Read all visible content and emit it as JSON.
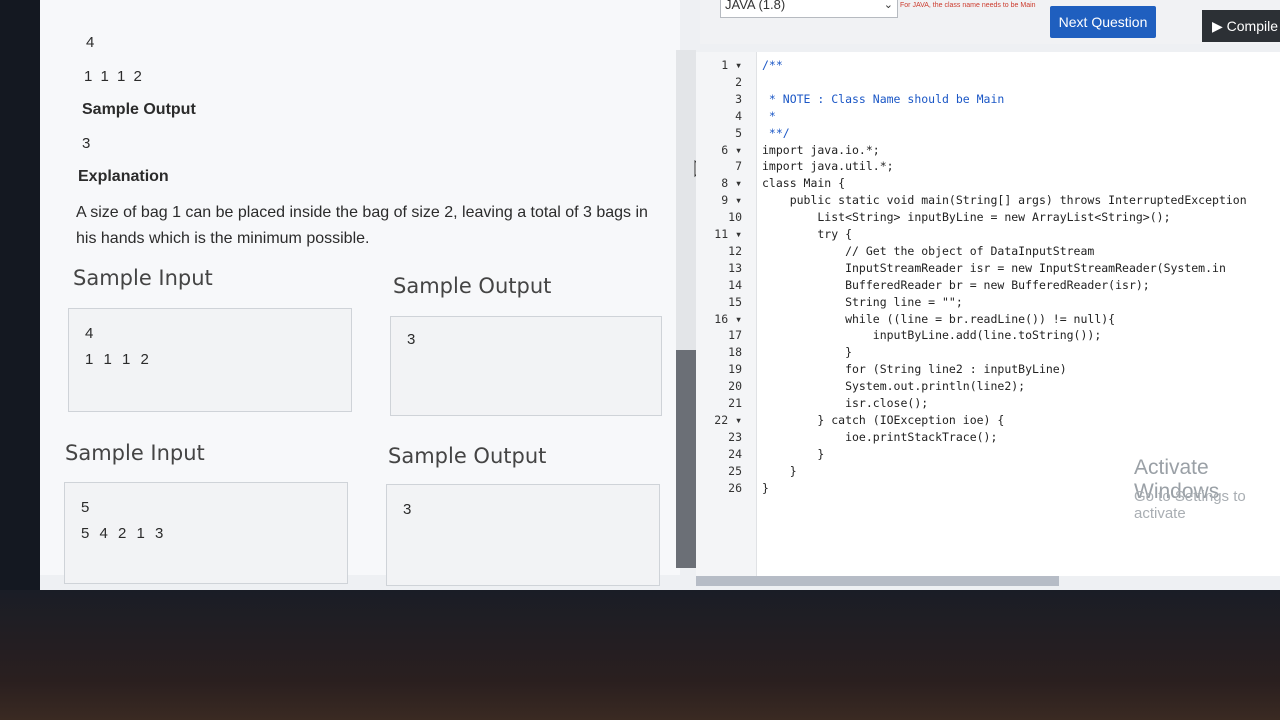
{
  "problem": {
    "top_value_1": "4",
    "top_value_2": "1 1 1 2",
    "sample_output_heading": "Sample Output",
    "sample_output_value": "3",
    "explanation_heading": "Explanation",
    "explanation_text": "A size of bag 1 can be placed inside the bag of size 2, leaving a total of 3 bags in his hands which is the minimum possible.",
    "examples": [
      {
        "input_label": "Sample Input",
        "output_label": "Sample Output",
        "input_lines": [
          "4",
          "1 1 1 2"
        ],
        "output": "3"
      },
      {
        "input_label": "Sample Input",
        "output_label": "Sample Output",
        "input_lines": [
          "5",
          "5 4 2 1 3"
        ],
        "output": "3"
      }
    ]
  },
  "toolbar": {
    "language": "JAVA (1.8)",
    "note": "For JAVA, the class name needs to be Main",
    "next_label": "Next Question",
    "compile_label": "▶ Compile"
  },
  "editor": {
    "line_numbers": [
      "1",
      "2",
      "3",
      "4",
      "5",
      "6",
      "7",
      "8",
      "9",
      "10",
      "11",
      "12",
      "13",
      "14",
      "15",
      "16",
      "17",
      "18",
      "19",
      "20",
      "21",
      "22",
      "23",
      "24",
      "25",
      "26"
    ],
    "lines": [
      "/**",
      "",
      " * NOTE : Class Name should be Main",
      " *",
      " **/",
      "import java.io.*;",
      "import java.util.*;",
      "class Main {",
      "    public static void main(String[] args) throws InterruptedException",
      "        List<String> inputByLine = new ArrayList<String>();",
      "        try {",
      "            // Get the object of DataInputStream",
      "            InputStreamReader isr = new InputStreamReader(System.in",
      "            BufferedReader br = new BufferedReader(isr);",
      "            String line = \"\";",
      "            while ((line = br.readLine()) != null){",
      "                inputByLine.add(line.toString());",
      "            }",
      "            for (String line2 : inputByLine)",
      "            System.out.println(line2);",
      "            isr.close();",
      "        } catch (IOException ioe) {",
      "            ioe.printStackTrace();",
      "        }",
      "    }",
      "}"
    ]
  },
  "watermark": {
    "title": "Activate Windows",
    "subtitle": "Go to Settings to activate"
  }
}
